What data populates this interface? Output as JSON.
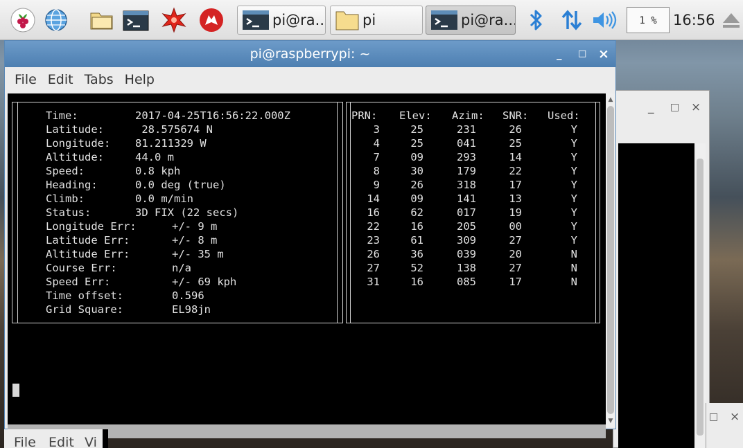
{
  "taskbar": {
    "tasks": [
      {
        "label": "pi@ra...",
        "icon": "terminal-icon",
        "active": false
      },
      {
        "label": "pi",
        "icon": "folder-icon",
        "active": false
      },
      {
        "label": "pi@ra...",
        "icon": "terminal-icon",
        "active": true
      }
    ],
    "cpu_usage": "1 %",
    "clock": "16:56"
  },
  "window": {
    "title": "pi@raspberrypi: ~",
    "minimize": "_",
    "maximize": "□",
    "close": "×",
    "menu": [
      "File",
      "Edit",
      "Tabs",
      "Help"
    ]
  },
  "back_window": {
    "minimize": "_",
    "maximize": "□",
    "close": "×"
  },
  "bottom_window": {
    "menu": [
      "File",
      "Edit",
      "Vi"
    ]
  },
  "gps": {
    "fields": [
      {
        "label": "Time:",
        "value": "2017-04-25T16:56:22.000Z"
      },
      {
        "label": "Latitude:",
        "value": " 28.575674 N"
      },
      {
        "label": "Longitude:",
        "value": "81.211329 W"
      },
      {
        "label": "Altitude:",
        "value": "44.0 m"
      },
      {
        "label": "Speed:",
        "value": "0.8 kph"
      },
      {
        "label": "Heading:",
        "value": "0.0 deg (true)"
      },
      {
        "label": "Climb:",
        "value": "0.0 m/min"
      },
      {
        "label": "Status:",
        "value": "3D FIX (22 secs)"
      },
      {
        "label": "Longitude Err:",
        "value": "+/- 9 m"
      },
      {
        "label": "Latitude Err:",
        "value": "+/- 8 m"
      },
      {
        "label": "Altitude Err:",
        "value": "+/- 35 m"
      },
      {
        "label": "Course Err:",
        "value": "n/a"
      },
      {
        "label": "Speed Err:",
        "value": "+/- 69 kph"
      },
      {
        "label": "Time offset:",
        "value": "0.596"
      },
      {
        "label": "Grid Square:",
        "value": "EL98jn"
      }
    ],
    "sat_headers": [
      "PRN:",
      "Elev:",
      "Azim:",
      "SNR:",
      "Used:"
    ],
    "satellites": [
      [
        "3",
        "25",
        "231",
        "26",
        "Y"
      ],
      [
        "4",
        "25",
        "041",
        "25",
        "Y"
      ],
      [
        "7",
        "09",
        "293",
        "14",
        "Y"
      ],
      [
        "8",
        "30",
        "179",
        "22",
        "Y"
      ],
      [
        "9",
        "26",
        "318",
        "17",
        "Y"
      ],
      [
        "14",
        "09",
        "141",
        "13",
        "Y"
      ],
      [
        "16",
        "62",
        "017",
        "19",
        "Y"
      ],
      [
        "22",
        "16",
        "205",
        "00",
        "Y"
      ],
      [
        "23",
        "61",
        "309",
        "27",
        "Y"
      ],
      [
        "26",
        "36",
        "039",
        "20",
        "N"
      ],
      [
        "27",
        "52",
        "138",
        "27",
        "N"
      ],
      [
        "31",
        "16",
        "085",
        "17",
        "N"
      ]
    ]
  }
}
